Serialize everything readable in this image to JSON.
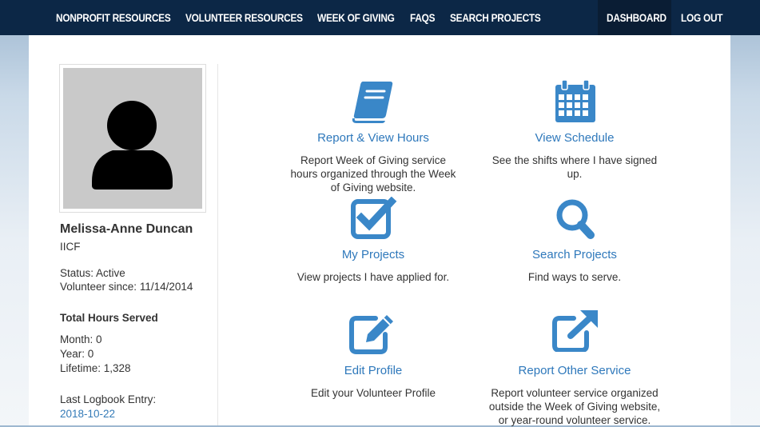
{
  "nav": {
    "items": [
      {
        "label": "NONPROFIT RESOURCES"
      },
      {
        "label": "VOLUNTEER RESOURCES"
      },
      {
        "label": "WEEK OF GIVING"
      },
      {
        "label": "FAQS"
      },
      {
        "label": "SEARCH PROJECTS"
      }
    ],
    "dashboard": "DASHBOARD",
    "logout": "LOG OUT"
  },
  "profile": {
    "name": "Melissa-Anne Duncan",
    "org": "IICF",
    "status": "Status: Active",
    "since": "Volunteer since: 11/14/2014",
    "hours_heading": "Total Hours Served",
    "month": "Month: 0",
    "year": "Year: 0",
    "lifetime": "Lifetime: 1,328",
    "logbook_label": "Last Logbook Entry:",
    "logbook_date": "2018-10-22"
  },
  "tiles": [
    {
      "title": "Report & View Hours",
      "icon": "book-icon",
      "desc": [
        "Report Week of Giving service",
        "hours organized through the Week",
        "of Giving website."
      ]
    },
    {
      "title": "View Schedule",
      "icon": "calendar-icon",
      "desc": [
        "See the shifts where I have signed",
        "up."
      ]
    },
    {
      "title": "My Projects",
      "icon": "checkbox-icon",
      "desc": [
        "View projects I have applied for."
      ]
    },
    {
      "title": "Search Projects",
      "icon": "search-icon",
      "desc": [
        "Find ways to serve."
      ]
    },
    {
      "title": "Edit Profile",
      "icon": "edit-icon",
      "desc": [
        "Edit your Volunteer Profile"
      ]
    },
    {
      "title": "Report Other Service",
      "icon": "external-link-icon",
      "desc": [
        "Report volunteer service organized",
        "outside the Week of Giving website,",
        "or year-round volunteer service."
      ]
    }
  ],
  "colors": {
    "nav_bg": "#0c2746",
    "accent": "#3a87c8",
    "link": "#337ab7"
  }
}
